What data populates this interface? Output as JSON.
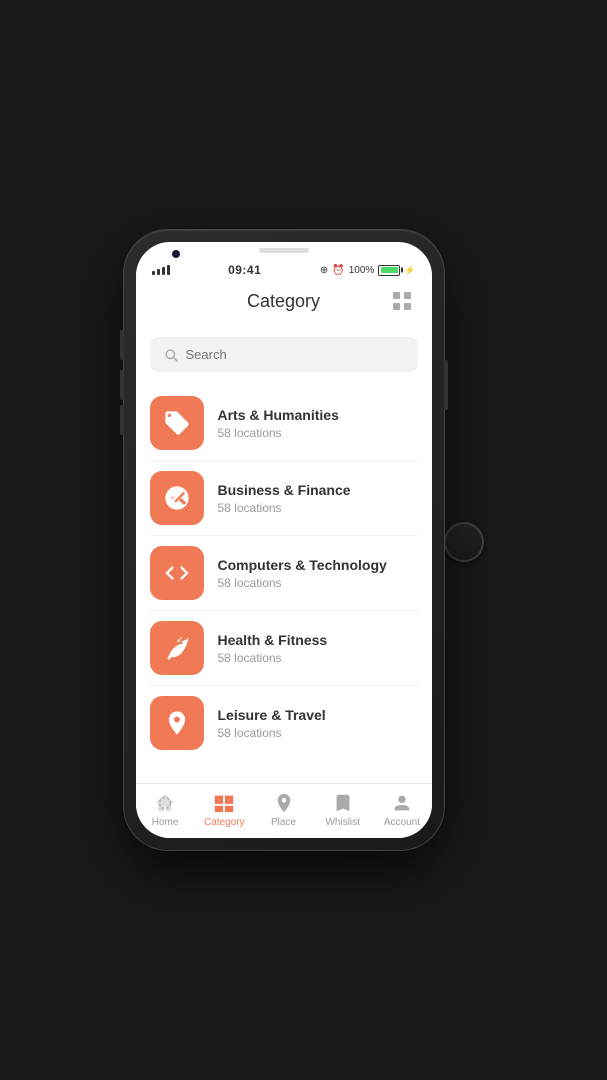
{
  "status_bar": {
    "time": "09:41",
    "battery_percent": "100%",
    "signal": "signal"
  },
  "header": {
    "title": "Category",
    "grid_icon": "grid-icon"
  },
  "search": {
    "placeholder": "Search"
  },
  "categories": [
    {
      "name": "Arts & Humanities",
      "count": "58 locations",
      "icon": "tag"
    },
    {
      "name": "Business & Finance",
      "count": "58 locations",
      "icon": "handshake"
    },
    {
      "name": "Computers & Technology",
      "count": "58 locations",
      "icon": "code"
    },
    {
      "name": "Health & Fitness",
      "count": "58 locations",
      "icon": "leaf"
    },
    {
      "name": "Leisure & Travel",
      "count": "58 locations",
      "icon": "map-pin"
    }
  ],
  "bottom_nav": [
    {
      "label": "Home",
      "icon": "compass",
      "active": false
    },
    {
      "label": "Category",
      "icon": "layers",
      "active": true
    },
    {
      "label": "Place",
      "icon": "map-pin-nav",
      "active": false
    },
    {
      "label": "Whislist",
      "icon": "bookmark",
      "active": false
    },
    {
      "label": "Account",
      "icon": "person",
      "active": false
    }
  ],
  "colors": {
    "accent": "#f07a55",
    "active_nav": "#f07a55",
    "inactive": "#999999"
  }
}
